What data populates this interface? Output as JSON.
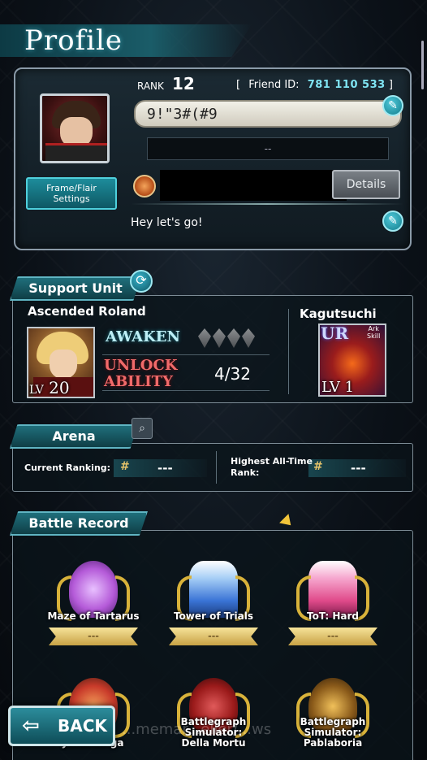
{
  "page": {
    "title": "Profile"
  },
  "profile": {
    "rank_label": "RANK",
    "rank_value": "12",
    "friend_id_label": "Friend ID:",
    "friend_id": "781 110 533",
    "name": "9!\"3#(#9",
    "title_value": "--",
    "frame_button": "Frame/Flair Settings",
    "details_button": "Details",
    "comment": "Hey let's go!"
  },
  "support": {
    "section_label": "Support Unit",
    "unit_name": "Ascended Roland",
    "unit_level_prefix": "LV",
    "unit_level": "20",
    "awaken_label": "AWAKEN",
    "awaken_gems": 4,
    "unlock_label_1": "UNLOCK",
    "unlock_label_2": "ABILITY",
    "unlock_count": "4/32",
    "esper_name": "Kagutsuchi",
    "esper_rarity": "UR",
    "esper_badge_1": "Ark",
    "esper_badge_2": "Skill",
    "esper_level_prefix": "LV",
    "esper_level": "1"
  },
  "arena": {
    "section_label": "Arena",
    "current_ranking_label": "Current Ranking:",
    "current_ranking_value": "---",
    "highest_rank_label_1": "Highest All-Time",
    "highest_rank_label_2": "Rank:",
    "highest_rank_value": "---"
  },
  "battle_record": {
    "section_label": "Battle Record",
    "items": [
      {
        "name": "Maze of Tartarus",
        "value": "---",
        "color": "#b45ad8"
      },
      {
        "name": "Tower of Trials",
        "value": "---",
        "color": "#3a74d6"
      },
      {
        "name": "ToT: Hard",
        "value": "---",
        "color": "#e04a8a"
      },
      {
        "name_1": "",
        "name_2": "Jalabalinga",
        "color": "#c83a2a"
      },
      {
        "name_1": "Battlegraph",
        "name_2": "Simulator:",
        "name_3": "Della Mortu",
        "color": "#9a1a1a"
      },
      {
        "name_1": "Battlegraph",
        "name_2": "Simulator:",
        "name_3": "Pablaboria",
        "color": "#8a5a1a"
      }
    ]
  },
  "nav": {
    "back_label": "BACK"
  },
  "watermark": "...memar...eller/...ws"
}
